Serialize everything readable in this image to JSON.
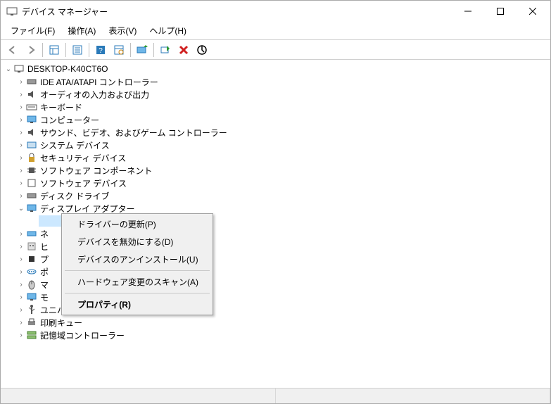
{
  "window": {
    "title": "デバイス マネージャー"
  },
  "menubar": {
    "file": "ファイル(F)",
    "action": "操作(A)",
    "view": "表示(V)",
    "help": "ヘルプ(H)"
  },
  "tree": {
    "root": "DESKTOP-K40CT6O",
    "categories": [
      {
        "label": "IDE ATA/ATAPI コントローラー"
      },
      {
        "label": "オーディオの入力および出力"
      },
      {
        "label": "キーボード"
      },
      {
        "label": "コンピューター"
      },
      {
        "label": "サウンド、ビデオ、およびゲーム コントローラー"
      },
      {
        "label": "システム デバイス"
      },
      {
        "label": "セキュリティ デバイス"
      },
      {
        "label": "ソフトウェア コンポーネント"
      },
      {
        "label": "ソフトウェア デバイス"
      },
      {
        "label": "ディスク ドライブ"
      },
      {
        "label": "ディスプレイ アダプター",
        "expanded": true
      },
      {
        "label": "ネ"
      },
      {
        "label": "ヒ"
      },
      {
        "label": "プ"
      },
      {
        "label": "ポ"
      },
      {
        "label": "マ"
      },
      {
        "label": "モ"
      },
      {
        "label": "ユニバーサル シリアル バス コントローラー"
      },
      {
        "label": "印刷キュー"
      },
      {
        "label": "記憶域コントローラー"
      }
    ]
  },
  "context_menu": {
    "items": [
      {
        "label": "ドライバーの更新(P)"
      },
      {
        "label": "デバイスを無効にする(D)"
      },
      {
        "label": "デバイスのアンインストール(U)"
      },
      {
        "sep": true
      },
      {
        "label": "ハードウェア変更のスキャン(A)"
      },
      {
        "sep": true
      },
      {
        "label": "プロパティ(R)",
        "bold": true
      }
    ]
  }
}
